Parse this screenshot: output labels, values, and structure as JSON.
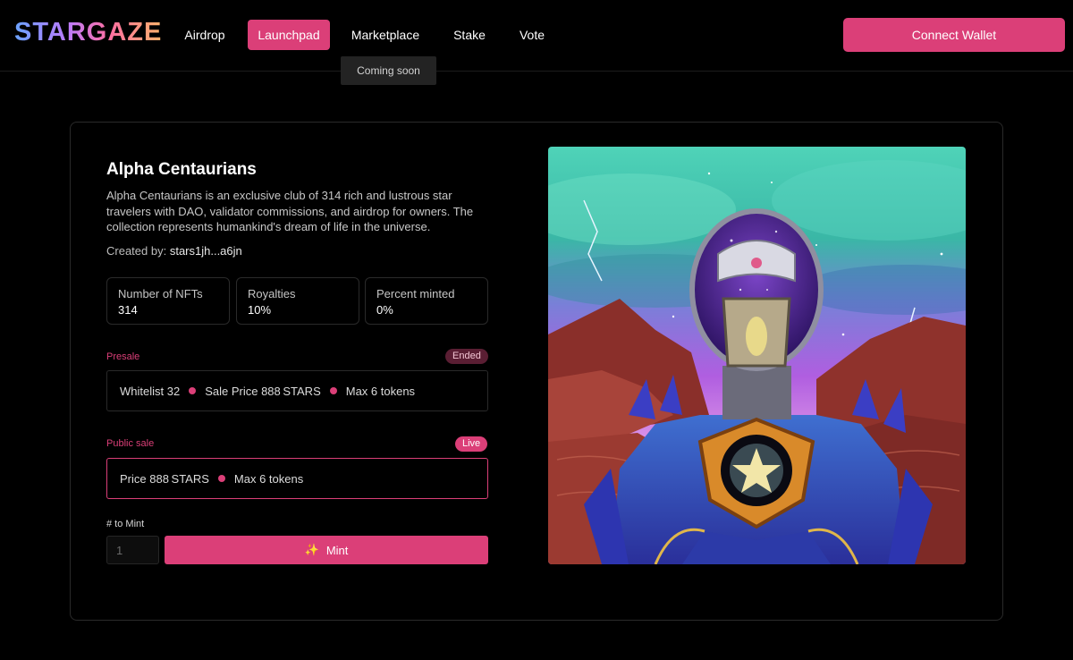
{
  "header": {
    "logo": "STARGAZE",
    "nav": [
      {
        "label": "Airdrop"
      },
      {
        "label": "Launchpad"
      },
      {
        "label": "Marketplace"
      },
      {
        "label": "Stake"
      },
      {
        "label": "Vote"
      }
    ],
    "tooltip": "Coming soon",
    "connect_label": "Connect Wallet"
  },
  "collection": {
    "title": "Alpha Centaurians",
    "description": "Alpha Centaurians is an exclusive club of 314 rich and lustrous star travelers with DAO, validator commissions, and airdrop for owners. The collection represents humankind's dream of life in the universe.",
    "created_by_label": "Created by:",
    "creator": "stars1jh...a6jn",
    "stats": [
      {
        "label": "Number of NFTs",
        "value": "314"
      },
      {
        "label": "Royalties",
        "value": "10%"
      },
      {
        "label": "Percent minted",
        "value": "0%"
      }
    ]
  },
  "presale": {
    "label": "Presale",
    "status": "Ended",
    "whitelist": "Whitelist 32",
    "price": "Sale Price 888 STARS",
    "max": "Max 6 tokens"
  },
  "public_sale": {
    "label": "Public sale",
    "status": "Live",
    "price": "Price 888 STARS",
    "max": "Max 6 tokens"
  },
  "mint": {
    "label": "# to Mint",
    "placeholder": "1",
    "button_label": "Mint"
  },
  "colors": {
    "accent": "#db3f78",
    "background": "#000000"
  }
}
